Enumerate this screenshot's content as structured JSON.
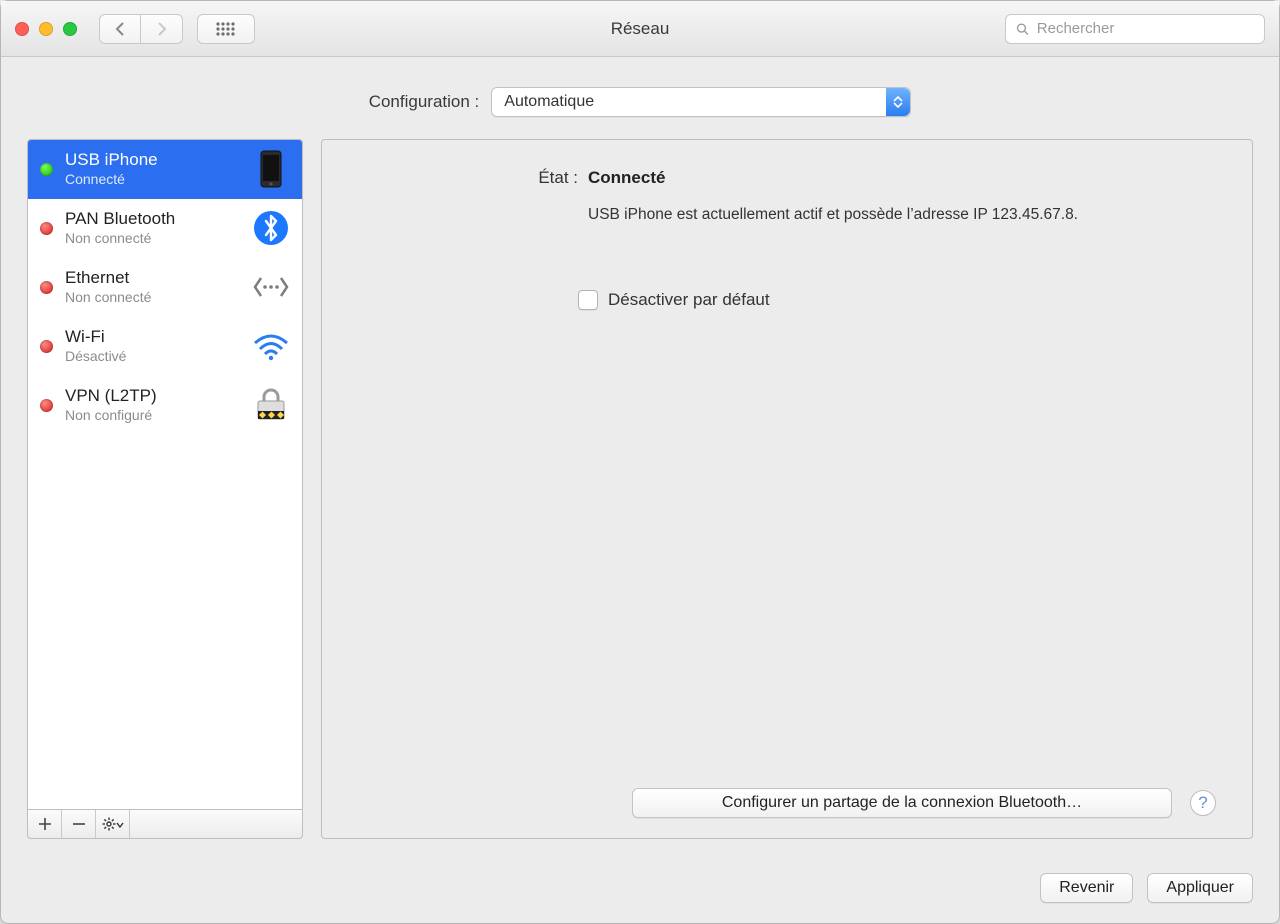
{
  "window": {
    "title": "Réseau"
  },
  "toolbar": {
    "search_placeholder": "Rechercher"
  },
  "config": {
    "label": "Configuration :",
    "value": "Automatique"
  },
  "sidebar": {
    "items": [
      {
        "name": "USB iPhone",
        "sub": "Connecté",
        "status": "green",
        "icon": "iphone",
        "selected": true
      },
      {
        "name": "PAN Bluetooth",
        "sub": "Non connecté",
        "status": "red",
        "icon": "bluetooth",
        "selected": false
      },
      {
        "name": "Ethernet",
        "sub": "Non connecté",
        "status": "red",
        "icon": "ethernet",
        "selected": false
      },
      {
        "name": "Wi-Fi",
        "sub": "Désactivé",
        "status": "red",
        "icon": "wifi",
        "selected": false
      },
      {
        "name": "VPN (L2TP)",
        "sub": "Non configuré",
        "status": "red",
        "icon": "vpn",
        "selected": false
      }
    ],
    "footer": {
      "add": "+",
      "remove": "−",
      "gear": "✱"
    }
  },
  "detail": {
    "status_label": "État :",
    "status_value": "Connecté",
    "status_desc": "USB iPhone  est actuellement actif et possède l’adresse IP 123.45.67.8.",
    "checkbox_label": "Désactiver par défaut",
    "configure_btn": "Configurer un partage de la connexion Bluetooth…",
    "help": "?"
  },
  "footer": {
    "revert": "Revenir",
    "apply": "Appliquer"
  }
}
